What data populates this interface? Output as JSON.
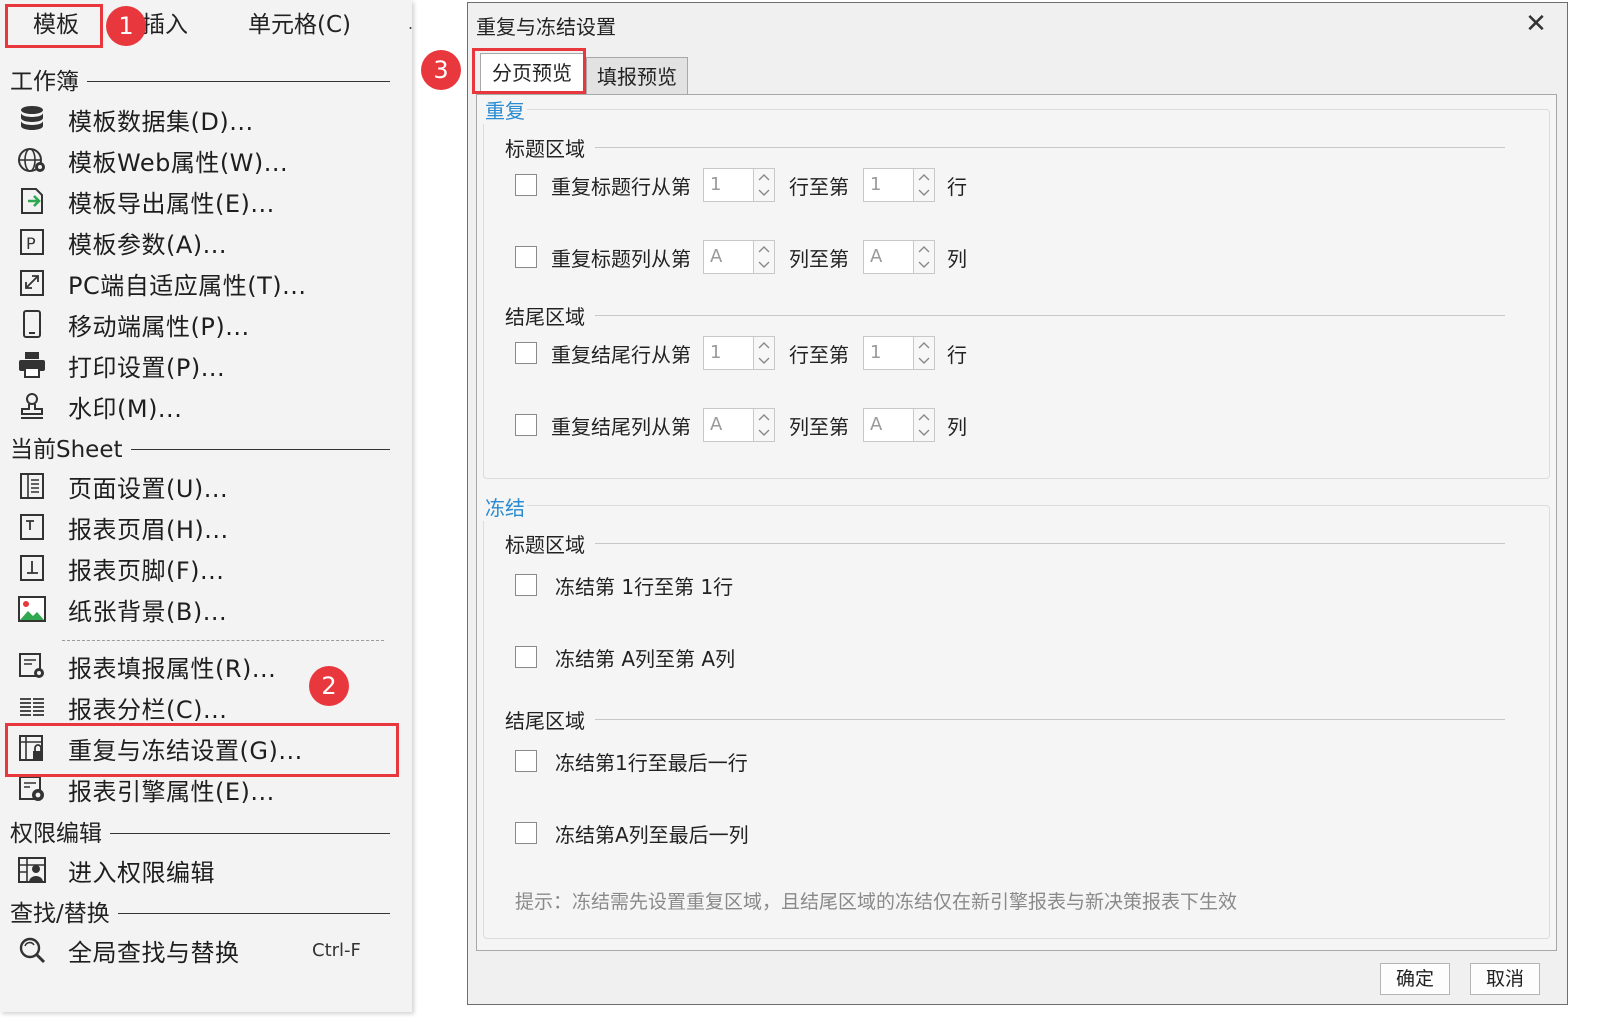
{
  "menubar": {
    "items": [
      "模板",
      "插入",
      "单元格(C)"
    ],
    "more": "."
  },
  "menu": {
    "sections": {
      "workbook": "工作簿",
      "current_sheet": "当前Sheet",
      "permission": "权限编辑",
      "find": "查找/替换"
    },
    "items": [
      {
        "label": "模板数据集(D)...",
        "icon": "database-icon"
      },
      {
        "label": "模板Web属性(W)...",
        "icon": "globe-gear-icon"
      },
      {
        "label": "模板导出属性(E)...",
        "icon": "export-icon"
      },
      {
        "label": "模板参数(A)...",
        "icon": "parameter-icon"
      },
      {
        "label": "PC端自适应属性(T)...",
        "icon": "expand-icon"
      },
      {
        "label": "移动端属性(P)...",
        "icon": "mobile-icon"
      },
      {
        "label": "打印设置(P)...",
        "icon": "printer-icon"
      },
      {
        "label": "水印(M)...",
        "icon": "stamp-icon"
      },
      {
        "label": "页面设置(U)...",
        "icon": "page-setup-icon"
      },
      {
        "label": "报表页眉(H)...",
        "icon": "header-icon"
      },
      {
        "label": "报表页脚(F)...",
        "icon": "footer-icon"
      },
      {
        "label": "纸张背景(B)...",
        "icon": "image-icon"
      },
      {
        "label": "报表填报属性(R)...",
        "icon": "form-settings-icon"
      },
      {
        "label": "报表分栏(C)...",
        "icon": "columns-icon"
      },
      {
        "label": "重复与冻结设置(G)...",
        "icon": "freeze-lock-icon"
      },
      {
        "label": "报表引擎属性(E)...",
        "icon": "engine-settings-icon"
      },
      {
        "label": "进入权限编辑",
        "icon": "permission-user-icon"
      },
      {
        "label": "全局查找与替换",
        "icon": "find-replace-icon",
        "shortcut": "Ctrl-F"
      }
    ]
  },
  "steps": [
    "1",
    "2",
    "3"
  ],
  "dialog": {
    "title": "重复与冻结设置",
    "close": "✕",
    "tabs": [
      "分页预览",
      "填报预览"
    ],
    "repeat_group": {
      "title": "重复",
      "title_area": "标题区域",
      "footer_area": "结尾区域",
      "rows": [
        {
          "label": "重复标题行从第",
          "from": "1",
          "mid": "行至第",
          "to": "1",
          "unit": "行"
        },
        {
          "label": "重复标题列从第",
          "from": "A",
          "mid": "列至第",
          "to": "A",
          "unit": "列"
        },
        {
          "label": "重复结尾行从第",
          "from": "1",
          "mid": "行至第",
          "to": "1",
          "unit": "行"
        },
        {
          "label": "重复结尾列从第",
          "from": "A",
          "mid": "列至第",
          "to": "A",
          "unit": "列"
        }
      ]
    },
    "freeze_group": {
      "title": "冻结",
      "title_area": "标题区域",
      "footer_area": "结尾区域",
      "rows": [
        "冻结第 1行至第 1行",
        "冻结第 A列至第 A列",
        "冻结第1行至最后一行",
        "冻结第A列至最后一列"
      ]
    },
    "hint": "提示：冻结需先设置重复区域，且结尾区域的冻结仅在新引擎报表与新决策报表下生效",
    "buttons": {
      "ok": "确定",
      "cancel": "取消"
    }
  },
  "colors": {
    "highlight": "#e8383d",
    "group_title": "#2a8bd0"
  }
}
